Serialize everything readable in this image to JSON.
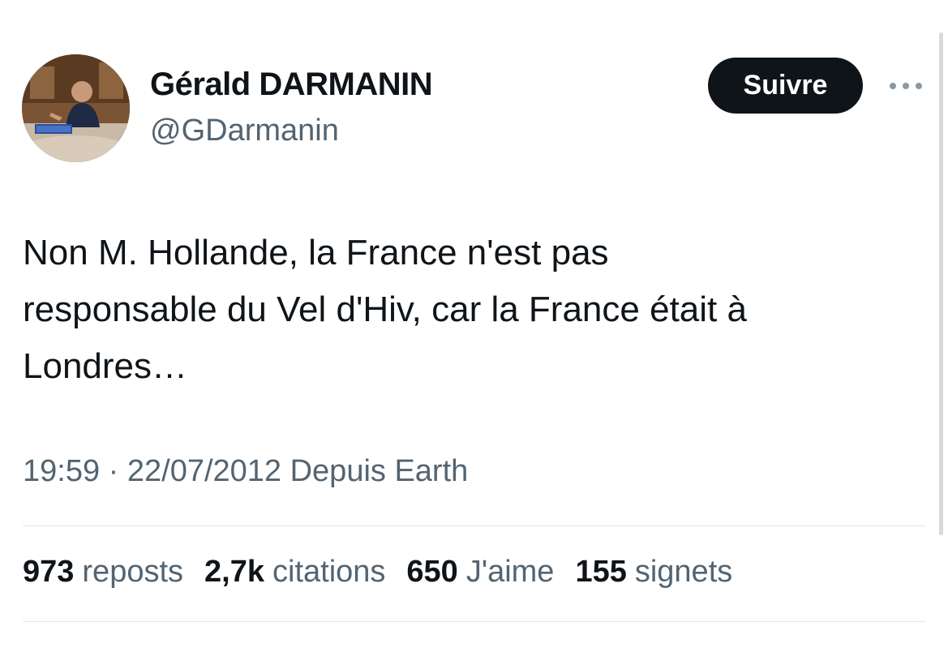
{
  "author": {
    "display_name": "Gérald DARMANIN",
    "handle": "@GDarmanin",
    "avatar_icon": "profile-photo"
  },
  "actions": {
    "follow_label": "Suivre",
    "more_icon": "more-horizontal-icon"
  },
  "tweet": {
    "text": "Non M. Hollande, la France n'est pas\nresponsable du Vel d'Hiv, car la France était à\nLondres…",
    "timestamp": "19:59 · 22/07/2012 Depuis Earth"
  },
  "stats": [
    {
      "count": "973",
      "label": "reposts"
    },
    {
      "count": "2,7k",
      "label": "citations"
    },
    {
      "count": "650",
      "label": "J'aime"
    },
    {
      "count": "155",
      "label": "signets"
    }
  ],
  "colors": {
    "text_primary": "#0f1419",
    "text_secondary": "#536471",
    "button_bg": "#0f1419",
    "divider": "#e1e6ea"
  }
}
